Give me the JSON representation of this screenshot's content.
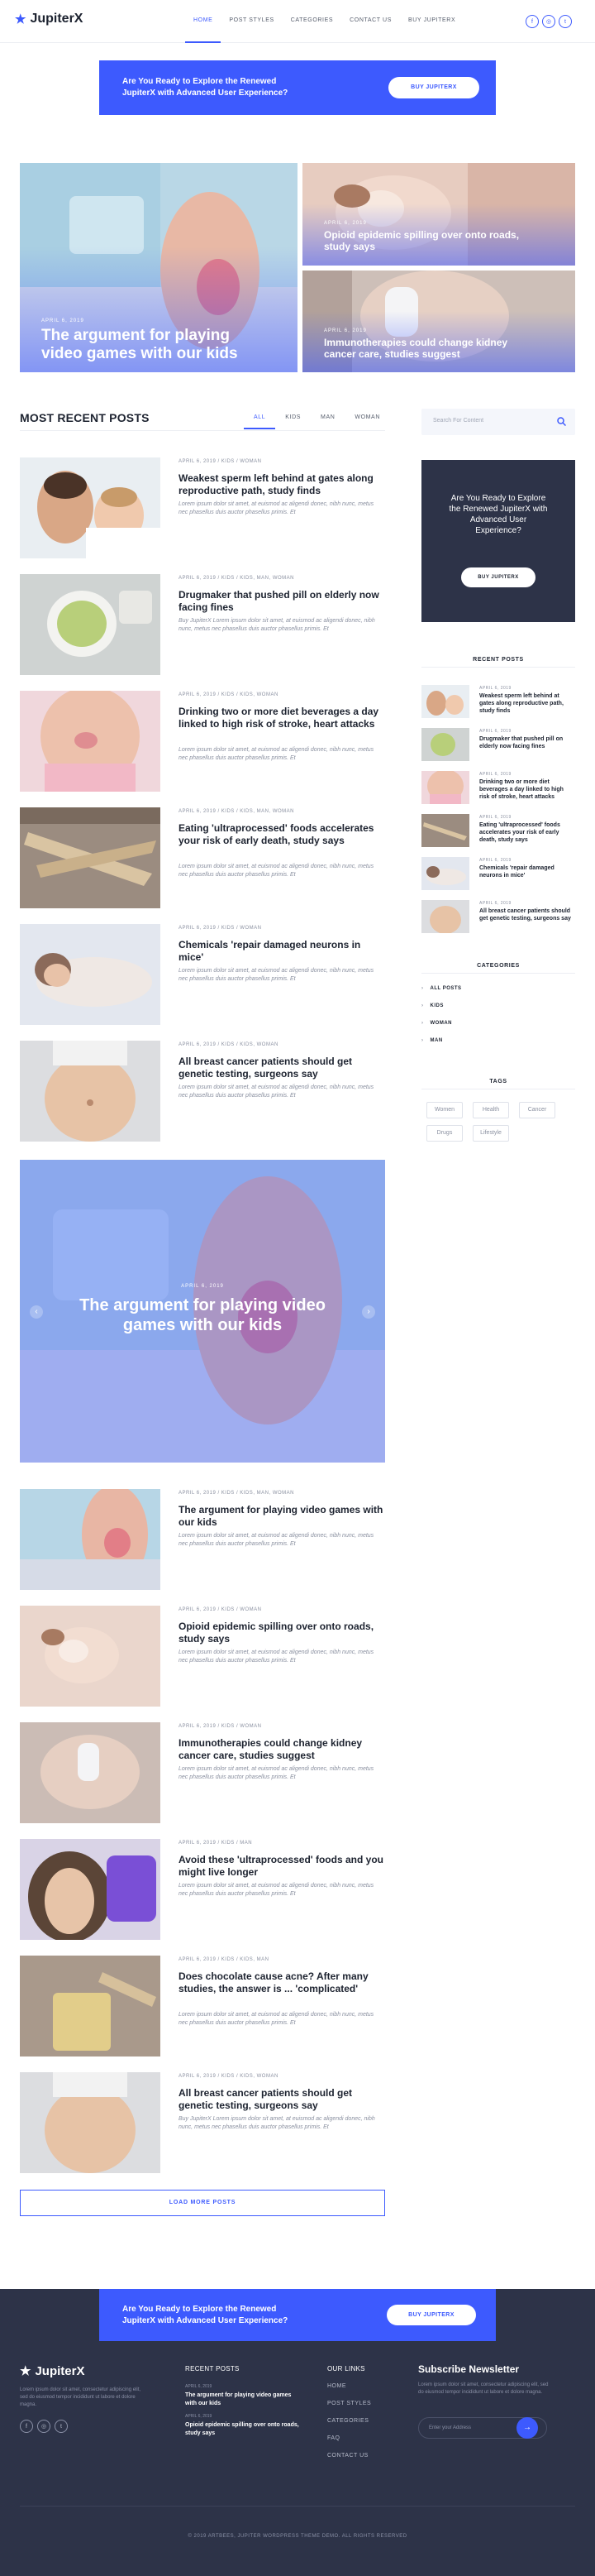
{
  "header": {
    "logo": "JupiterX",
    "nav": [
      "HOME",
      "POST STYLES",
      "CATEGORIES",
      "CONTACT US",
      "BUY JUPITERX"
    ],
    "social_icons": [
      "facebook-icon",
      "instagram-icon",
      "twitter-icon"
    ]
  },
  "promo": {
    "line1": "Are You Ready to Explore the Renewed",
    "line2": "JupiterX with Advanced User Experience?",
    "button": "BUY JUPITERX"
  },
  "hero": {
    "main": {
      "date": "APRIL 6, 2019",
      "title_l1": "The argument for playing",
      "title_l2": "video games with our kids"
    },
    "top_right": {
      "date": "APRIL 6, 2019",
      "title_l1": "Opioid epidemic spilling over onto roads,",
      "title_l2": "study says"
    },
    "bottom_right": {
      "date": "APRIL 6, 2019",
      "title_l1": "Immunotherapies could change kidney",
      "title_l2": "cancer care, studies suggest"
    }
  },
  "recent": {
    "heading": "MOST RECENT POSTS",
    "tabs": [
      "ALL",
      "KIDS",
      "MAN",
      "WOMAN"
    ]
  },
  "posts": [
    {
      "meta": "APRIL 6, 2019 / KIDS / WOMAN",
      "title": "Weakest sperm left behind at gates along reproductive path, study finds",
      "excerpt": "Lorem ipsum dolor sit amet, at euismod ac aligendi donec, nibh nunc, metus nec phasellus duis auctor phasellus primis. Et"
    },
    {
      "meta": "APRIL 6, 2019 / KIDS / KIDS, MAN, WOMAN",
      "title": "Drugmaker that pushed pill on elderly now facing fines",
      "excerpt": "Buy JupiterX Lorem ipsum dolor sit amet, at euismod ac aligendi donec, nibh nunc, metus nec phasellus duis auctor phasellus primis. Et"
    },
    {
      "meta": "APRIL 6, 2019 / KIDS / KIDS, WOMAN",
      "title": "Drinking two or more diet beverages a day linked to high risk of stroke, heart attacks",
      "excerpt": "Lorem ipsum dolor sit amet, at euismod ac aligendi donec, nibh nunc, metus nec phasellus duis auctor phasellus primis. Et"
    },
    {
      "meta": "APRIL 6, 2019 / KIDS / KIDS, MAN, WOMAN",
      "title": "Eating 'ultraprocessed' foods accelerates your risk of early death, study says",
      "excerpt": "Lorem ipsum dolor sit amet, at euismod ac aligendi donec, nibh nunc, metus nec phasellus duis auctor phasellus primis. Et"
    },
    {
      "meta": "APRIL 6, 2019 / KIDS / WOMAN",
      "title": "Chemicals 'repair damaged neurons in mice'",
      "excerpt": "Lorem ipsum dolor sit amet, at euismod ac aligendi donec, nibh nunc, metus nec phasellus duis auctor phasellus primis. Et"
    },
    {
      "meta": "APRIL 6, 2019 / KIDS / KIDS, WOMAN",
      "title": "All breast cancer patients should get genetic testing, surgeons say",
      "excerpt": "Lorem ipsum dolor sit amet, at euismod ac aligendi donec, nibh nunc, metus nec phasellus duis auctor phasellus primis. Et"
    }
  ],
  "slider": {
    "date": "APRIL 6, 2019",
    "title_l1": "The argument for playing video",
    "title_l2": "games with our kids"
  },
  "posts2": [
    {
      "meta": "APRIL 6, 2019 / KIDS / KIDS, MAN, WOMAN",
      "title": "The argument for playing video games with our kids",
      "excerpt": "Lorem ipsum dolor sit amet, at euismod ac aligendi donec, nibh nunc, metus nec phasellus duis auctor phasellus primis. Et"
    },
    {
      "meta": "APRIL 6, 2019 / KIDS / WOMAN",
      "title": "Opioid epidemic spilling over onto roads, study says",
      "excerpt": "Lorem ipsum dolor sit amet, at euismod ac aligendi donec, nibh nunc, metus nec phasellus duis auctor phasellus primis. Et"
    },
    {
      "meta": "APRIL 6, 2019 / KIDS / WOMAN",
      "title": "Immunotherapies could change kidney cancer care, studies suggest",
      "excerpt": "Lorem ipsum dolor sit amet, at euismod ac aligendi donec, nibh nunc, metus nec phasellus duis auctor phasellus primis. Et"
    },
    {
      "meta": "APRIL 6, 2019 / KIDS / MAN",
      "title": "Avoid these 'ultraprocessed' foods and you might live longer",
      "excerpt": "Lorem ipsum dolor sit amet, at euismod ac aligendi donec, nibh nunc, metus nec phasellus duis auctor phasellus primis. Et"
    },
    {
      "meta": "APRIL 6, 2019 / KIDS / KIDS, MAN",
      "title": "Does chocolate cause acne? After many studies, the answer is ... 'complicated'",
      "excerpt": "Lorem ipsum dolor sit amet, at euismod ac aligendi donec, nibh nunc, metus nec phasellus duis auctor phasellus primis. Et"
    },
    {
      "meta": "APRIL 6, 2019 / KIDS / KIDS, WOMAN",
      "title": "All breast cancer patients should get genetic testing, surgeons say",
      "excerpt": "Buy JupiterX Lorem ipsum dolor sit amet, at euismod ac aligendi donec, nibh nunc, metus nec phasellus duis auctor phasellus primis. Et"
    }
  ],
  "load_more": "LOAD MORE POSTS",
  "sidebar": {
    "search_placeholder": "Search For Content",
    "cta": {
      "l1": "Are You Ready to Explore",
      "l2": "the Renewed JupiterX with",
      "l3": "Advanced User",
      "l4": "Experience?",
      "button": "BUY JUPITERX"
    },
    "recent_heading": "RECENT POSTS",
    "recent": [
      {
        "date": "APRIL 6, 2019",
        "title": "Weakest sperm left behind at gates along reproductive path, study finds"
      },
      {
        "date": "APRIL 6, 2019",
        "title": "Drugmaker that pushed pill on elderly now facing fines"
      },
      {
        "date": "APRIL 6, 2019",
        "title": "Drinking two or more diet beverages a day linked to high risk of stroke, heart attacks"
      },
      {
        "date": "APRIL 6, 2019",
        "title": "Eating 'ultraprocessed' foods accelerates your risk of early death, study says"
      },
      {
        "date": "APRIL 6, 2019",
        "title": "Chemicals 'repair damaged neurons in mice'"
      },
      {
        "date": "APRIL 6, 2019",
        "title": "All breast cancer patients should get genetic testing, surgeons say"
      }
    ],
    "categories_heading": "CATEGORIES",
    "categories": [
      "ALL POSTS",
      "KIDS",
      "WOMAN",
      "MAN"
    ],
    "tags_heading": "TAGS",
    "tags": [
      "Women",
      "Health",
      "Cancer",
      "Drugs",
      "Lifestyle"
    ]
  },
  "footer_promo": {
    "line1": "Are You Ready to Explore the Renewed",
    "line2": "JupiterX with Advanced User Experience?",
    "button": "BUY JUPITERX"
  },
  "footer": {
    "logo": "JupiterX",
    "about": "Lorem ipsum dolor sit amet, consectetur adipiscing elit, sed do eiusmod tempor incididunt ut labore et dolore magna.",
    "recent_heading": "RECENT POSTS",
    "recent": [
      {
        "date": "APRIL 6, 2019",
        "title": "The argument for playing video games with our kids"
      },
      {
        "date": "APRIL 6, 2019",
        "title": "Opioid epidemic spilling over onto roads, study says"
      }
    ],
    "links_heading": "OUR LINKS",
    "links": [
      "HOME",
      "POST STYLES",
      "CATEGORIES",
      "FAQ",
      "CONTACT US"
    ],
    "newsletter_heading": "Subscribe Newsletter",
    "newsletter_text": "Lorem ipsum dolor sit amet, consectetur adipiscing elit, sed do eiusmod tempor incididunt ut labore et dolore magna.",
    "email_placeholder": "Enter your Address",
    "copyright": "© 2019 ARTBEES, JUPITER WORDPRESS THEME DEMO. ALL RIGHTS RESERVED"
  },
  "colors": {
    "accent": "#3d5afe",
    "dark": "#2d3348"
  }
}
